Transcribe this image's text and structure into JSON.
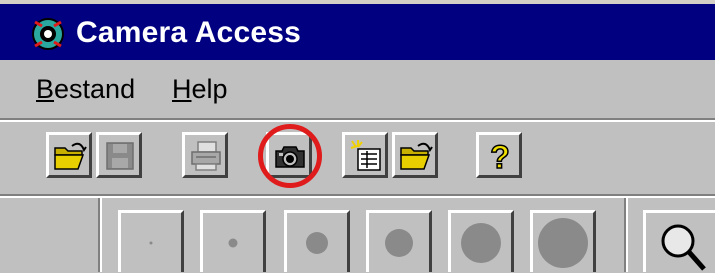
{
  "window": {
    "title": "Camera Access",
    "icon": "camera-access-app-icon"
  },
  "menu": [
    {
      "accel": "B",
      "rest": "estand"
    },
    {
      "accel": "H",
      "rest": "elp"
    }
  ],
  "toolbar": {
    "buttons": [
      {
        "name": "open-folder",
        "icon": "open-folder-icon"
      },
      {
        "name": "save",
        "icon": "floppy-disk-icon"
      },
      {
        "name": "print",
        "icon": "printer-icon"
      },
      {
        "name": "camera",
        "icon": "camera-icon",
        "highlighted": true
      },
      {
        "name": "new-sheet",
        "icon": "new-sheet-icon"
      },
      {
        "name": "open-folder-2",
        "icon": "open-folder-icon"
      },
      {
        "name": "help",
        "icon": "question-mark-icon"
      }
    ],
    "highlight_color": "#e01b1b"
  },
  "palette": {
    "brush_sizes": [
      "smallest",
      "small",
      "medium",
      "medium-large",
      "large",
      "largest"
    ],
    "zoom_icon": "magnifier-icon"
  },
  "colors": {
    "title_bar": "#000080",
    "face": "#c0c0c0"
  }
}
